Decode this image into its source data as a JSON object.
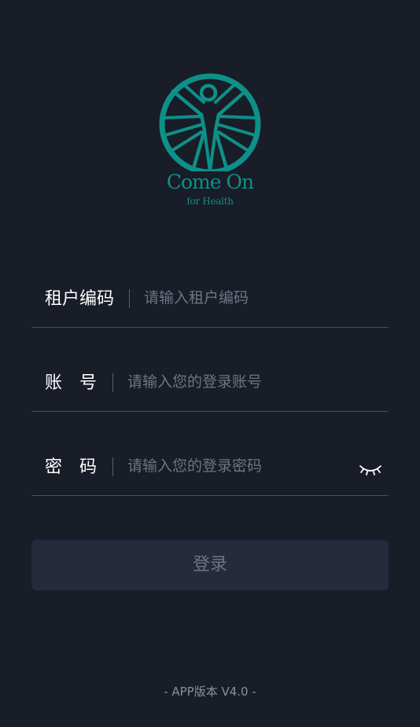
{
  "logo": {
    "title": "Come On",
    "subtitle": "for Health",
    "color": "#0d9088"
  },
  "form": {
    "tenant": {
      "label": "租户编码",
      "placeholder": "请输入租户编码",
      "value": ""
    },
    "account": {
      "label": "账　号",
      "placeholder": "请输入您的登录账号",
      "value": ""
    },
    "password": {
      "label": "密　码",
      "placeholder": "请输入您的登录密码",
      "value": "",
      "toggle_icon": "eye-closed-icon"
    }
  },
  "login_button": {
    "label": "登录"
  },
  "footer": {
    "version": "- APP版本 V4.0 -"
  },
  "colors": {
    "background": "#181d28",
    "button_bg": "#252a3c",
    "button_text": "#6e7486",
    "divider": "#4a505c",
    "placeholder": "#6e7480"
  }
}
